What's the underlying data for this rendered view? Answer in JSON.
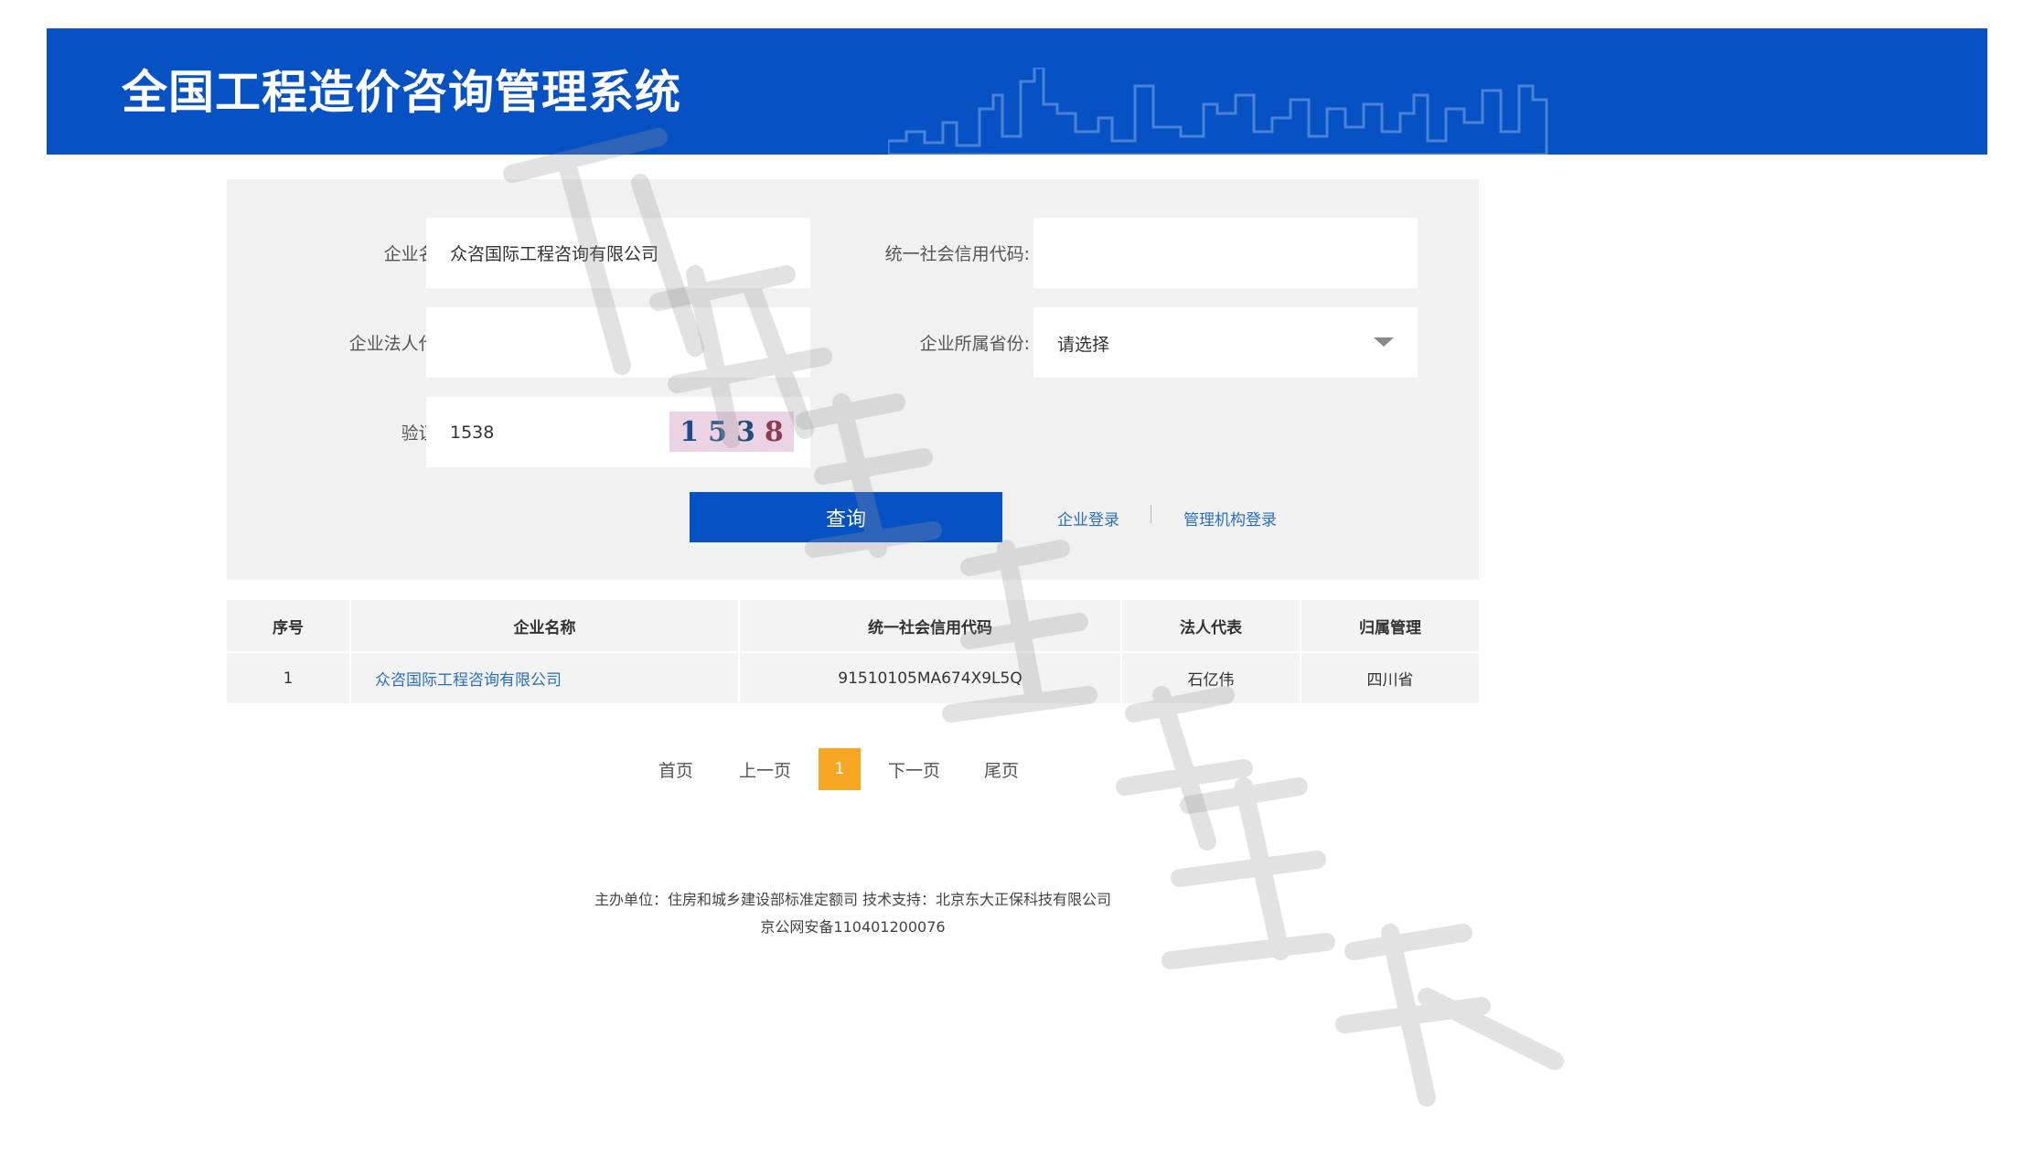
{
  "header": {
    "title": "全国工程造价咨询管理系统"
  },
  "search": {
    "company_name_label": "企业名称:",
    "company_name_value": "众咨国际工程咨询有限公司",
    "credit_code_label": "统一社会信用代码:",
    "credit_code_value": "",
    "legal_rep_label": "企业法人代表:",
    "legal_rep_value": "",
    "province_label": "企业所属省份:",
    "province_value": "请选择",
    "captcha_label": "验证码:",
    "captcha_value": "1538",
    "captcha_digits": [
      "1",
      "5",
      "3",
      "8"
    ],
    "query_button": "查询",
    "company_login": "企业登录",
    "agency_login": "管理机构登录"
  },
  "table": {
    "headers": [
      "序号",
      "企业名称",
      "统一社会信用代码",
      "法人代表",
      "归属管理"
    ],
    "rows": [
      [
        "1",
        "众咨国际工程咨询有限公司",
        "91510105MA674X9L5Q",
        "石亿伟",
        "四川省"
      ]
    ]
  },
  "pagination": {
    "first": "首页",
    "prev": "上一页",
    "current": "1",
    "next": "下一页",
    "last": "尾页"
  },
  "footer": {
    "line1": "主办单位：住房和城乡建设部标准定额司 技术支持：北京东大正保科技有限公司",
    "line2": "京公网安备110401200076"
  },
  "colors": {
    "brand_blue": "#0652c5",
    "panel_gray": "#f1f1f1",
    "link_blue": "#2a6fbf",
    "pager_active": "#f5a623"
  }
}
